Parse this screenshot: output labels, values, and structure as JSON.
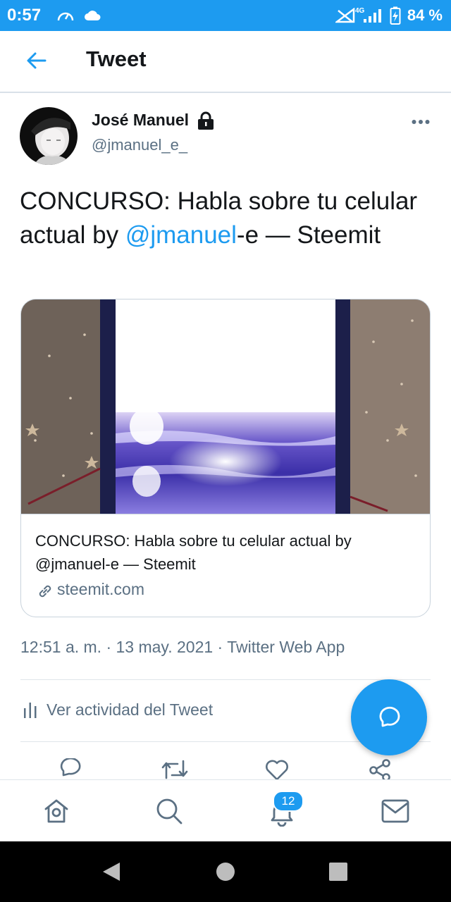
{
  "status_bar": {
    "time": "0:57",
    "network": "4G",
    "battery": "84 %"
  },
  "header": {
    "title": "Tweet"
  },
  "tweet": {
    "author_name": "José Manuel",
    "author_handle": "@jmanuel_e_",
    "text_before": "CONCURSO: Habla sobre tu celular actual by ",
    "text_mention": "@jmanuel",
    "text_after": "-e — Steemit",
    "card": {
      "title": "CONCURSO: Habla sobre tu celular actual by @jmanuel-e — Steemit",
      "domain": "steemit.com"
    },
    "timestamp": "12:51 a. m. · 13 may. 2021 · Twitter Web App",
    "activity_label": "Ver actividad del Tweet"
  },
  "bottom_nav": {
    "notifications_badge": "12"
  },
  "colors": {
    "accent": "#1d9bf0",
    "text_primary": "#14171a",
    "text_secondary": "#5b7083"
  },
  "icons": [
    "speed-icon",
    "cloud-icon",
    "no-signal-icon",
    "signal-icon",
    "battery-charging-icon",
    "back-arrow-icon",
    "lock-icon",
    "more-options-icon",
    "link-icon",
    "activity-bars-icon",
    "compose-icon",
    "reply-icon",
    "retweet-icon",
    "like-icon",
    "share-icon",
    "home-icon",
    "search-icon",
    "notifications-icon",
    "messages-icon",
    "nav-back-icon",
    "nav-home-icon",
    "nav-recents-icon"
  ]
}
